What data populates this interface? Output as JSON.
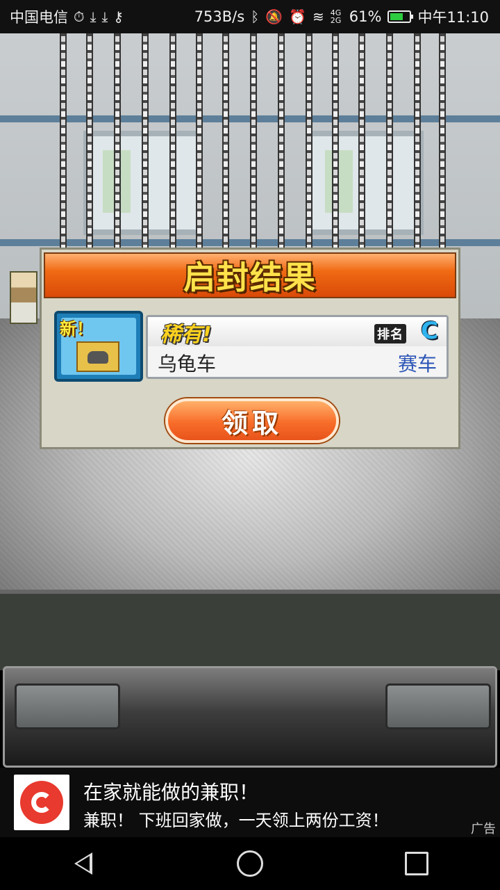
{
  "status_bar": {
    "carrier": "中国电信",
    "net_speed": "753B/s",
    "signal_type": "4G 2G",
    "battery": "61%",
    "time": "中午11:10"
  },
  "dialog": {
    "title": "启封结果",
    "item": {
      "new_badge": "新！",
      "rarity": "稀有!",
      "rank_label": "排名",
      "rank_value": "C",
      "name": "乌龟车",
      "category": "赛车"
    },
    "claim_button": "领取"
  },
  "ad": {
    "title": "在家就能做的兼职！",
    "description": "兼职！ 下班回家做，一天领上两份工资！",
    "tag": "广告"
  }
}
